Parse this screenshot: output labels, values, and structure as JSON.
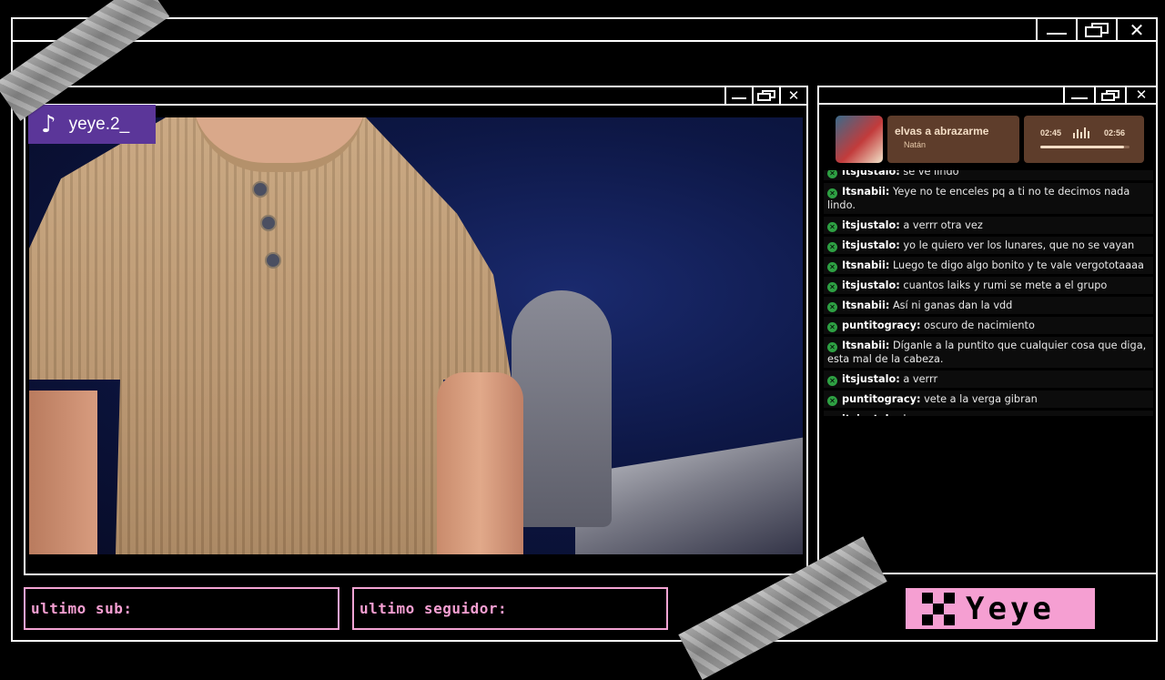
{
  "stream": {
    "platform_icon": "tiktok-icon",
    "username": "yeye.2_"
  },
  "music": {
    "song": "elvas a abrazarme",
    "artist": "Natán",
    "current_time": "02:45",
    "total_time": "02:56",
    "progress": 0.94
  },
  "chat": {
    "messages": [
      {
        "user": "itsjustalo:",
        "text": "se ve lindo"
      },
      {
        "user": "Itsnabii:",
        "text": "Yeye no te enceles pq a ti no te decimos nada lindo."
      },
      {
        "user": "itsjustalo:",
        "text": "a verrr otra vez"
      },
      {
        "user": "itsjustalo:",
        "text": "yo le quiero ver los lunares, que no se vayan"
      },
      {
        "user": "Itsnabii:",
        "text": "Luego te digo algo bonito y te vale vergototaaaa"
      },
      {
        "user": "itsjustalo:",
        "text": "cuantos laiks y rumi se mete a el grupo"
      },
      {
        "user": "Itsnabii:",
        "text": "Así ni ganas dan la vdd"
      },
      {
        "user": "puntitogracy:",
        "text": "oscuro de nacimiento"
      },
      {
        "user": "Itsnabii:",
        "text": "Díganle a la puntito que cualquier cosa que diga, esta mal de la cabeza."
      },
      {
        "user": "itsjustalo:",
        "text": "a verrr"
      },
      {
        "user": "puntitogracy:",
        "text": "vete a la verga gibran"
      },
      {
        "user": "itsjustalo:",
        "text": "lunares"
      }
    ]
  },
  "bottom": {
    "last_sub_label": "ultimo sub:",
    "last_follower_label": "ultimo seguidor:",
    "streamer_name": "Yeye"
  },
  "colors": {
    "accent_pink": "#f59fd2",
    "badge_purple": "#5b3699",
    "music_brown": "#5e3d2b",
    "chat_badge_green": "#2ea043"
  }
}
